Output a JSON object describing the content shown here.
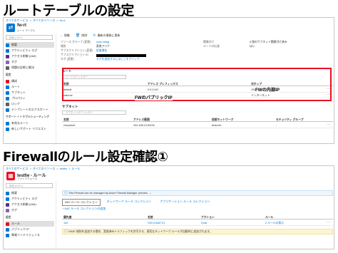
{
  "headings": {
    "route_table": "ルートテーブルの設定",
    "firewall": "Firewallのルール設定確認①"
  },
  "shot1": {
    "breadcrumb": [
      "すべてのサービス",
      "すべてのリソース",
      "fw-rt"
    ],
    "resource_title": "fw-rt",
    "resource_subtitle": "ルート テーブル",
    "search_placeholder": "検索 (Ctrl+/)",
    "sidebar_items": [
      {
        "label": "概要",
        "color": "#0078d4",
        "active": true
      },
      {
        "label": "アクティビティ ログ",
        "color": "#0078d4"
      },
      {
        "label": "アクセス制御 (IAM)",
        "color": "#5c2d91"
      },
      {
        "label": "タグ",
        "color": "#8764b8"
      },
      {
        "label": "問題の診断と解決",
        "color": "#605e5c"
      }
    ],
    "settings_heading": "設定",
    "settings_items": [
      {
        "label": "構成",
        "color": "#e81123"
      },
      {
        "label": "ルート",
        "color": "#0078d4"
      },
      {
        "label": "サブネット",
        "color": "#0078d4"
      },
      {
        "label": "プロパティ",
        "color": "#0078d4"
      },
      {
        "label": "ロック",
        "color": "#605e5c"
      },
      {
        "label": "テンプレートのエクスポート",
        "color": "#0078d4"
      }
    ],
    "support_heading": "サポート + トラブルシューティング",
    "support_items": [
      {
        "label": "有効なルート",
        "color": "#0078d4"
      },
      {
        "label": "新しいサポート リクエスト",
        "color": "#0078d4"
      }
    ],
    "toolbar": [
      "移動",
      "削除",
      "最新の情報に更新"
    ],
    "essentials": {
      "rg_key": "リソース グループ (変更)",
      "rg_val": "rudy-netrgt",
      "loc_key": "場所",
      "loc_val": "東南アジア",
      "sub_key": "サブスクリプション (変更)",
      "sub_val": "従量課金",
      "subid_key": "サブスクリプション ID",
      "tag_key": "タグ (変更)",
      "tag_val": "タグを追加するにはここをクリック",
      "assoc_key": "関連付け",
      "assoc_val": "0 個のサブネット関連付け済み",
      "route_key": "ルートの伝達",
      "route_val": "はい"
    },
    "routes_label": "ルート",
    "routes_filter": "ルートのフィルター",
    "routes_headers": [
      "名前",
      "アドレス プレフィックス",
      "次ホップ"
    ],
    "routes_rows": [
      {
        "name": "default",
        "prefix": "0.0.0.0/0",
        "nexthop": "192.168.10.4"
      },
      {
        "name": "internal",
        "prefix": "20.44.211.80/32",
        "nexthop": "インターネット"
      }
    ],
    "annotations": {
      "fw_internal_ip": "FWの内部IP",
      "fw_public_ip": "FWのパブリックIP"
    },
    "subnets_label": "サブネット",
    "subnets_filter": "サブネットのフィルター",
    "subnets_headers": [
      "名前",
      "アドレス範囲",
      "仮想ネットワーク",
      "セキュリティ グループ"
    ],
    "subnets_rows": [
      {
        "name": "vmsubnet",
        "range": "192.168.10.64/26",
        "vnet": "testvnet",
        "nsg": "-"
      }
    ]
  },
  "shot2": {
    "breadcrumb": [
      "すべてのサービス",
      "すべてのリソース",
      "testfw",
      "ルール"
    ],
    "resource_title": "testfw - ルール",
    "resource_subtitle": "ファイアウォール",
    "search_placeholder": "検索 (Ctrl+/)",
    "sidebar_items": [
      {
        "label": "概要",
        "color": "#0078d4"
      },
      {
        "label": "アクティビティ ログ",
        "color": "#0078d4"
      },
      {
        "label": "アクセス制御 (IAM)",
        "color": "#5c2d91"
      },
      {
        "label": "タグ",
        "color": "#8764b8"
      }
    ],
    "settings_heading": "設定",
    "settings_items": [
      {
        "label": "ルール",
        "color": "#e81123",
        "active": true
      },
      {
        "label": "パブリック IP",
        "color": "#0078d4"
      },
      {
        "label": "脅威インテリジェンス",
        "color": "#0078d4"
      }
    ],
    "info_banner": "This Firewall can be managed by Azure Firewall Manager preview. →",
    "tabs": [
      "NAT ルール コレクション",
      "ネットワーク ルール コレクション",
      "アプリケーション ルール コレクション"
    ],
    "add_label": "+ NAT ルール コレクションの追加",
    "rule_headers": [
      "優先度",
      "名前",
      "アクション",
      "ルール"
    ],
    "rule_rows": [
      {
        "priority": "100",
        "name": "SSH-DNAT-01",
        "action": "Dnat",
        "rules": "2 ルールの表示"
      }
    ],
    "warn_banner": "DNAT 規則を追加する場合、変換済みトラフィックを許可する、適切なネットワーク ルールが自動的に追加されます。"
  }
}
